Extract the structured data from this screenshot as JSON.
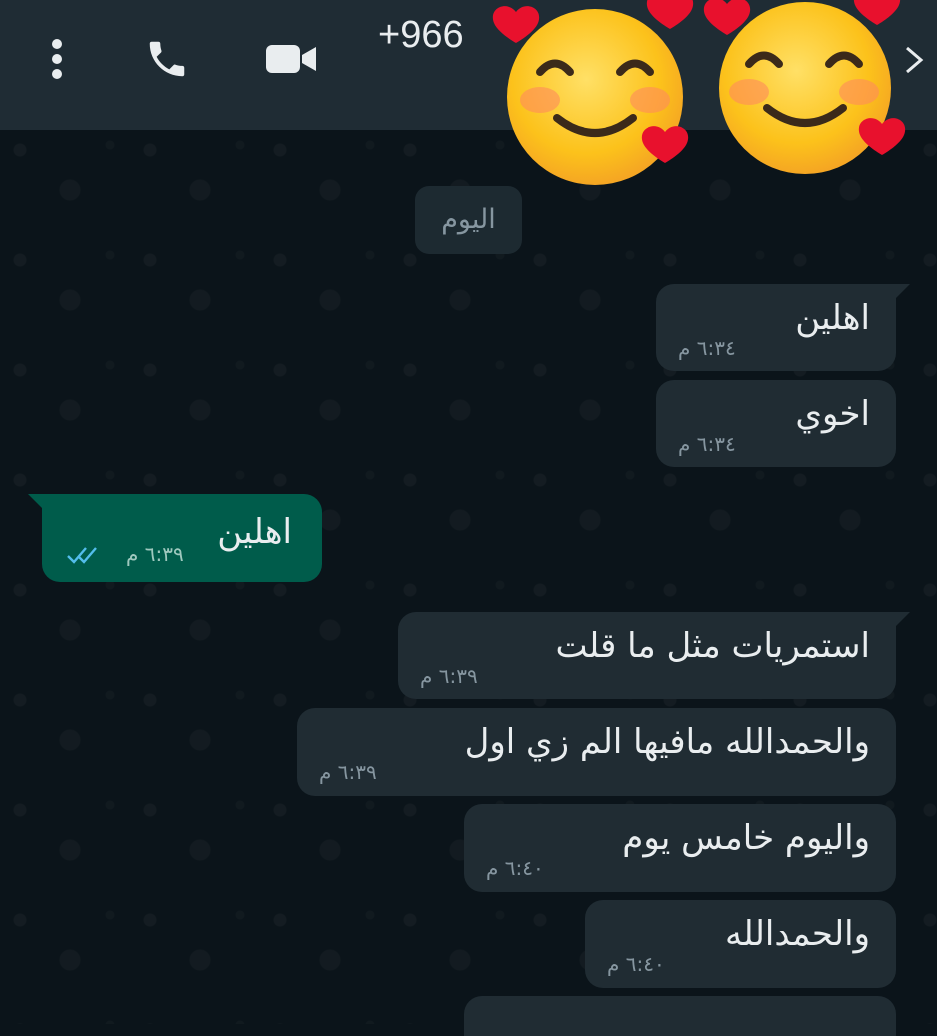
{
  "header": {
    "phone_number": "+966",
    "icons": [
      "more-vertical-icon",
      "call-icon",
      "video-call-icon",
      "forward-arrow-icon"
    ]
  },
  "stickers": [
    "smiling-hearts-emoji",
    "smiling-hearts-emoji"
  ],
  "date_chip": "اليوم",
  "messages": [
    {
      "text": "اهلين",
      "time": "٦:٣٤ م",
      "direction": "incoming"
    },
    {
      "text": "اخوي",
      "time": "٦:٣٤ م",
      "direction": "incoming"
    },
    {
      "text": "اهلين",
      "time": "٦:٣٩ م",
      "direction": "outgoing",
      "status": "read"
    },
    {
      "text": "استمريات مثل ما قلت",
      "time": "٦:٣٩ م",
      "direction": "incoming"
    },
    {
      "text": "والحمدالله مافيها الم زي اول",
      "time": "٦:٣٩ م",
      "direction": "incoming"
    },
    {
      "text": "واليوم خامس يوم",
      "time": "٦:٤٠ م",
      "direction": "incoming"
    },
    {
      "text": "والحمدالله",
      "time": "٦:٤٠ م",
      "direction": "incoming"
    }
  ],
  "colors": {
    "header": "#1f2c34",
    "background": "#0b141a",
    "incoming_bubble": "#202c33",
    "outgoing_bubble": "#005c4b",
    "read_ticks": "#53bdeb"
  }
}
